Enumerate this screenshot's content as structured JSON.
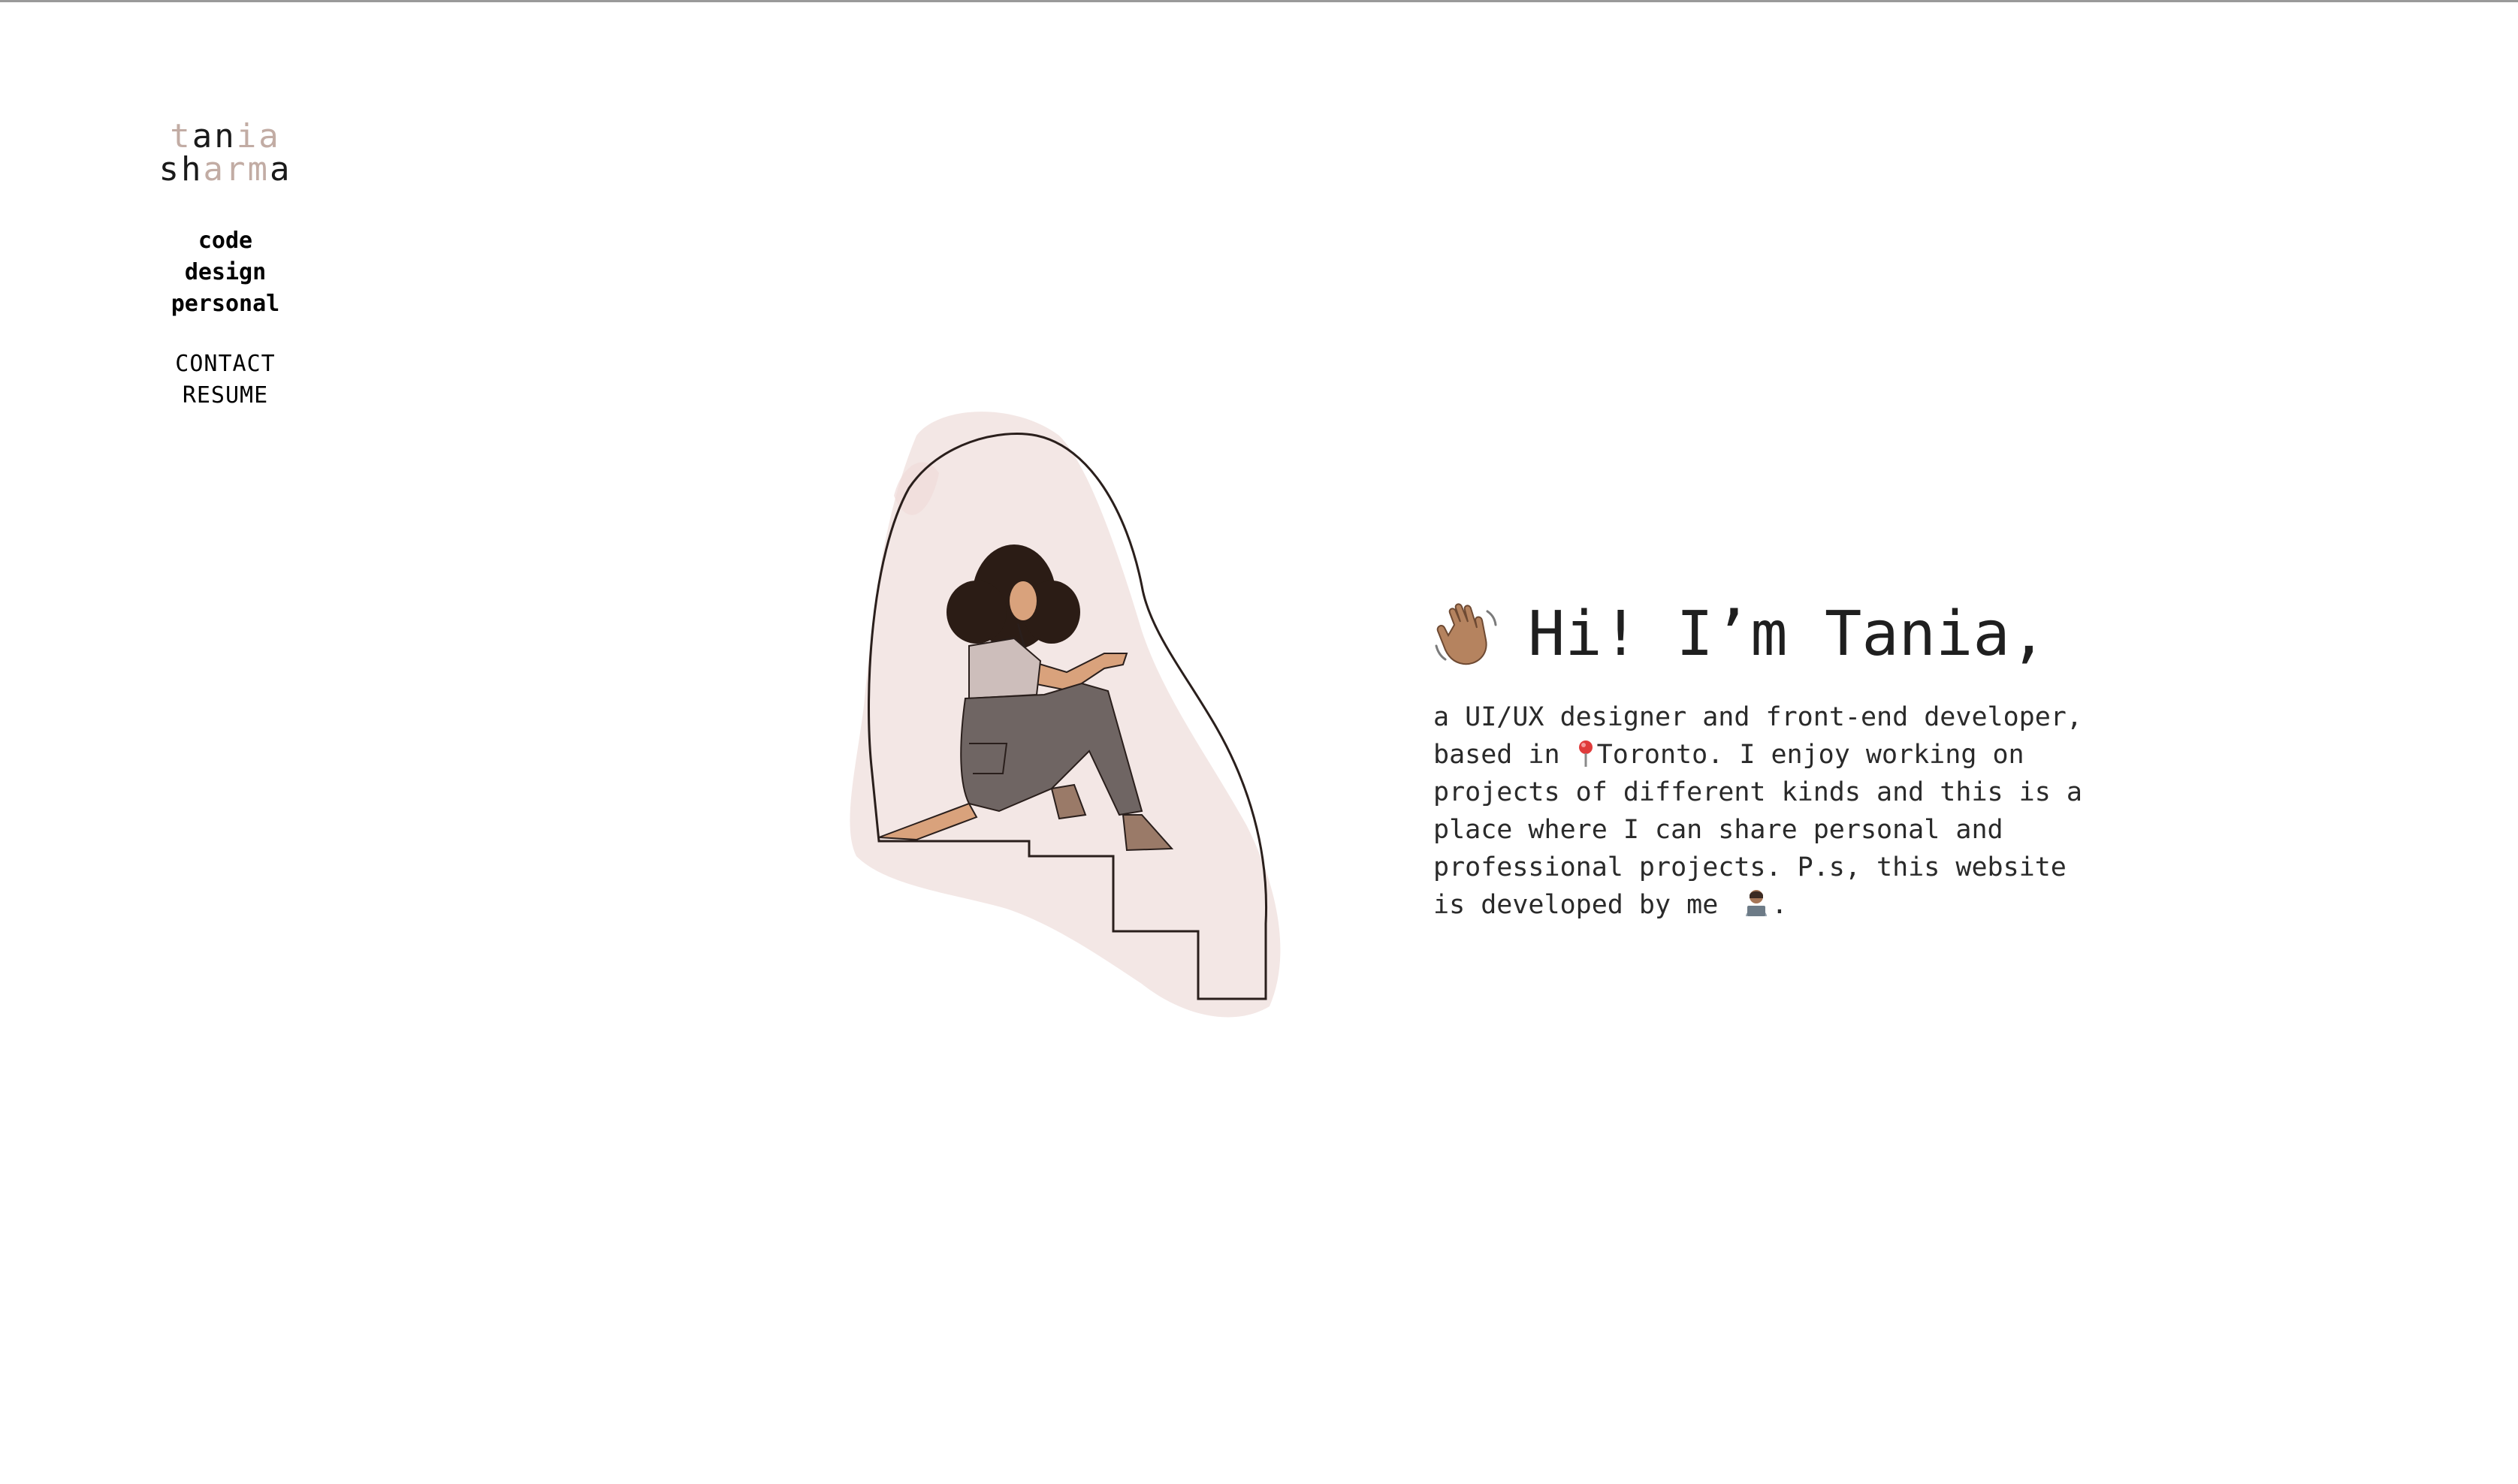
{
  "logo": {
    "line1": [
      {
        "ch": "t",
        "color": "#c2aca4"
      },
      {
        "ch": "a",
        "color": "#1a1a1a"
      },
      {
        "ch": "n",
        "color": "#1a1a1a"
      },
      {
        "ch": "i",
        "color": "#c2aca4"
      },
      {
        "ch": "a",
        "color": "#c2aca4"
      }
    ],
    "line2": [
      {
        "ch": "s",
        "color": "#1a1a1a"
      },
      {
        "ch": "h",
        "color": "#1a1a1a"
      },
      {
        "ch": "a",
        "color": "#c2aca4"
      },
      {
        "ch": "r",
        "color": "#c2aca4"
      },
      {
        "ch": "m",
        "color": "#c2aca4"
      },
      {
        "ch": "a",
        "color": "#1a1a1a"
      }
    ]
  },
  "nav": {
    "primary": [
      "code",
      "design",
      "personal"
    ],
    "secondary": [
      "CONTACT",
      "RESUME"
    ]
  },
  "intro": {
    "greeting": "Hi! I’m Tania,",
    "bio_part1": "a UI/UX designer and front-end developer, based in ",
    "bio_city": "Toronto",
    "bio_part2": ". I enjoy working on projects of different kinds and this is a place where I can share personal and professional projects. P.s, this website is developed by me ",
    "bio_end": ".",
    "icons": {
      "wave": "waving-hand-icon",
      "pin": "map-pin-icon",
      "developer": "technologist-icon"
    }
  },
  "colors": {
    "accent": "#c2aca4",
    "blush": "#f2e4e2",
    "text": "#1d1d1d"
  }
}
